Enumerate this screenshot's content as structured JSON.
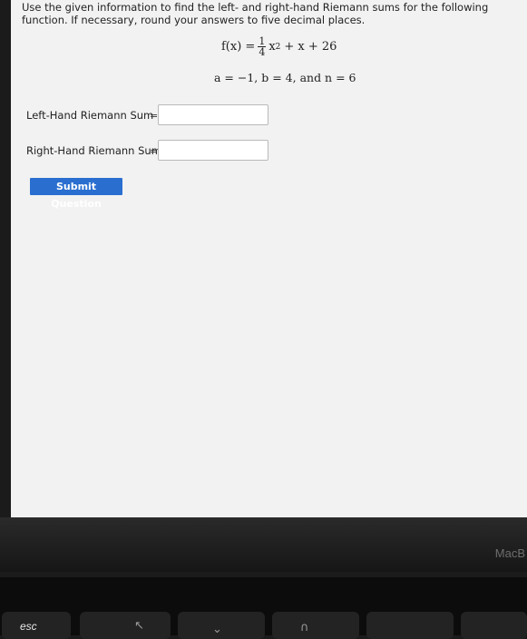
{
  "instructions": "Use the given information to find the left- and right-hand Riemann sums for the following function. If necessary, round your answers to five decimal places.",
  "formula": {
    "lhs": "f(x) =",
    "numerator": "1",
    "denominator": "4",
    "term1": "x",
    "exponent": "2",
    "rest": "+ x + 26"
  },
  "params": "a = −1, b = 4, and n = 6",
  "left_sum": {
    "label": "Left-Hand Riemann Sum",
    "eq": "=",
    "value": ""
  },
  "right_sum": {
    "label": "Right-Hand Riemann Sum",
    "eq": "=",
    "value": ""
  },
  "submit_label": "Submit Question",
  "brand_text": "MacB",
  "keyboard": {
    "esc_label": "esc"
  }
}
